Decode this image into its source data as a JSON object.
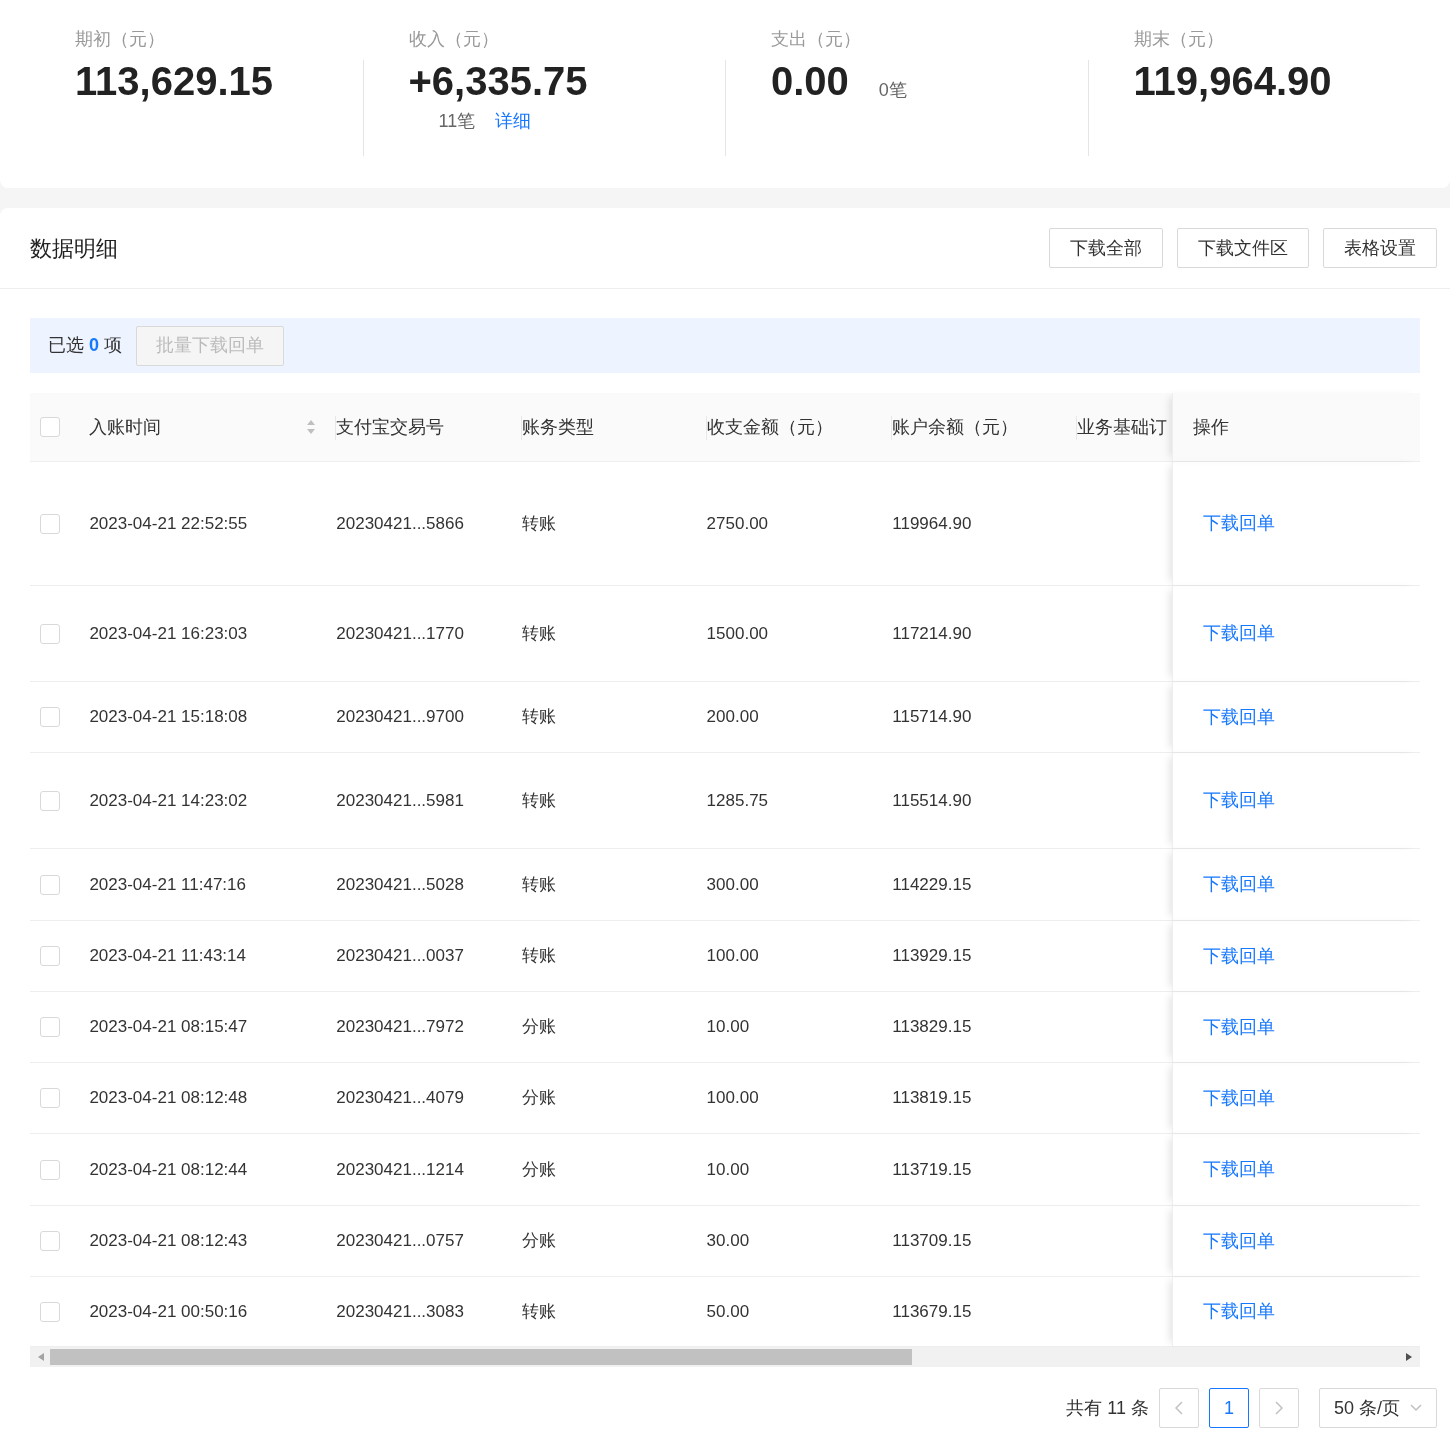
{
  "summary": [
    {
      "label": "期初（元）",
      "value": "113,629.15"
    },
    {
      "label": "收入（元）",
      "value": "+6,335.75",
      "count": "11笔",
      "link": "详细"
    },
    {
      "label": "支出（元）",
      "value": "0.00",
      "side_count": "0笔"
    },
    {
      "label": "期末（元）",
      "value": "119,964.90"
    }
  ],
  "section": {
    "title": "数据明细",
    "buttons": [
      "下载全部",
      "下载文件区",
      "表格设置"
    ]
  },
  "selection": {
    "prefix": "已选",
    "count": "0",
    "suffix": "项",
    "batch_button": {
      "label": "批量下载回单",
      "disabled": true
    }
  },
  "table": {
    "header_checkbox": {
      "checked": false
    },
    "columns": [
      {
        "label": "入账时间",
        "sortable": true
      },
      {
        "label": "支付宝交易号",
        "sortable": false
      },
      {
        "label": "账务类型",
        "sortable": false
      },
      {
        "label": "收支金额（元）",
        "sortable": false
      },
      {
        "label": "账户余额（元）",
        "sortable": false
      },
      {
        "label": "业务基础订",
        "sortable": false
      },
      {
        "label": "操作",
        "sortable": false
      }
    ],
    "rows": [
      {
        "checked": false,
        "time": "2023-04-21 22:52:55",
        "trade_no": "20230421...5866",
        "type": "转账",
        "amount": "2750.00",
        "balance": "119964.90",
        "action": "下载回单"
      },
      {
        "checked": false,
        "time": "2023-04-21 16:23:03",
        "trade_no": "20230421...1770",
        "type": "转账",
        "amount": "1500.00",
        "balance": "117214.90",
        "action": "下载回单"
      },
      {
        "checked": false,
        "time": "2023-04-21 15:18:08",
        "trade_no": "20230421...9700",
        "type": "转账",
        "amount": "200.00",
        "balance": "115714.90",
        "action": "下载回单"
      },
      {
        "checked": false,
        "time": "2023-04-21 14:23:02",
        "trade_no": "20230421...5981",
        "type": "转账",
        "amount": "1285.75",
        "balance": "115514.90",
        "action": "下载回单"
      },
      {
        "checked": false,
        "time": "2023-04-21 11:47:16",
        "trade_no": "20230421...5028",
        "type": "转账",
        "amount": "300.00",
        "balance": "114229.15",
        "action": "下载回单"
      },
      {
        "checked": false,
        "time": "2023-04-21 11:43:14",
        "trade_no": "20230421...0037",
        "type": "转账",
        "amount": "100.00",
        "balance": "113929.15",
        "action": "下载回单"
      },
      {
        "checked": false,
        "time": "2023-04-21 08:15:47",
        "trade_no": "20230421...7972",
        "type": "分账",
        "amount": "10.00",
        "balance": "113829.15",
        "action": "下载回单"
      },
      {
        "checked": false,
        "time": "2023-04-21 08:12:48",
        "trade_no": "20230421...4079",
        "type": "分账",
        "amount": "100.00",
        "balance": "113819.15",
        "action": "下载回单"
      },
      {
        "checked": false,
        "time": "2023-04-21 08:12:44",
        "trade_no": "20230421...1214",
        "type": "分账",
        "amount": "10.00",
        "balance": "113719.15",
        "action": "下载回单"
      },
      {
        "checked": false,
        "time": "2023-04-21 08:12:43",
        "trade_no": "20230421...0757",
        "type": "分账",
        "amount": "30.00",
        "balance": "113709.15",
        "action": "下载回单"
      },
      {
        "checked": false,
        "time": "2023-04-21 00:50:16",
        "trade_no": "20230421...3083",
        "type": "转账",
        "amount": "50.00",
        "balance": "113679.15",
        "action": "下载回单"
      }
    ]
  },
  "pagination": {
    "total": "共有 11 条",
    "pages": [
      {
        "label": "1",
        "selected": true
      }
    ],
    "page_size": "50 条/页"
  }
}
